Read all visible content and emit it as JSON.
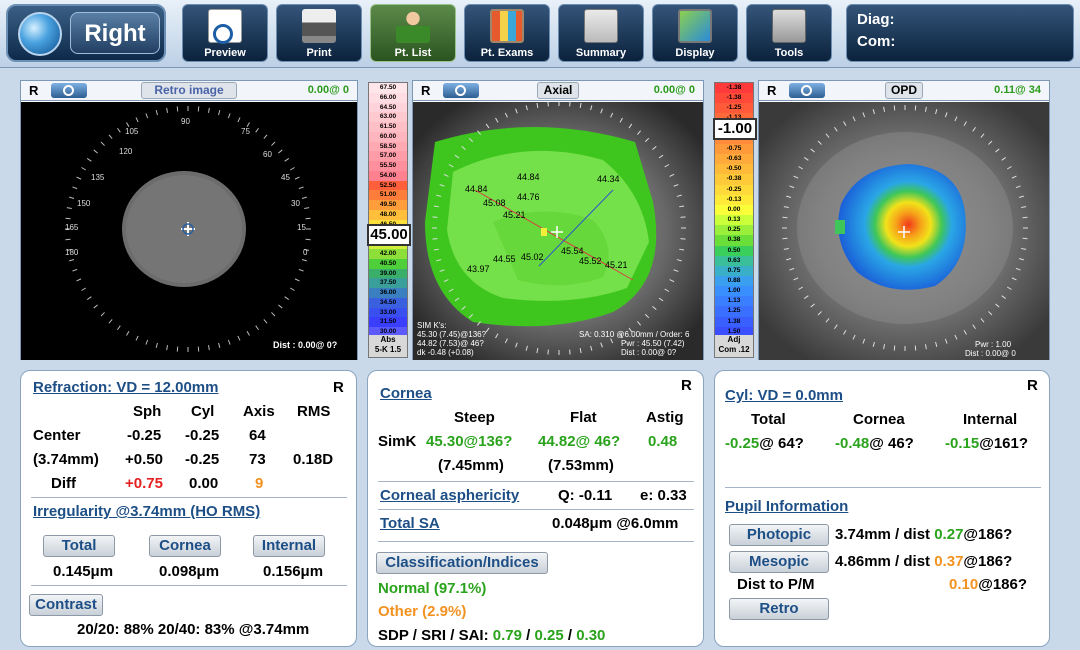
{
  "toolbar": {
    "eye": "Right",
    "buttons": [
      {
        "label": "Preview",
        "icon": "preview-icon"
      },
      {
        "label": "Print",
        "icon": "printer-icon"
      },
      {
        "label": "Pt. List",
        "icon": "patient-icon"
      },
      {
        "label": "Pt. Exams",
        "icon": "exams-icon"
      },
      {
        "label": "Summary",
        "icon": "summary-icon"
      },
      {
        "label": "Display",
        "icon": "display-icon"
      },
      {
        "label": "Tools",
        "icon": "tools-icon"
      }
    ],
    "diag": "Diag:",
    "com": "Com:"
  },
  "retro": {
    "eye": "R",
    "title": "Retro image",
    "value": "0.00@ 0",
    "dist": "Dist : 0.00@ 0?"
  },
  "axial": {
    "eye": "R",
    "title": "Axial",
    "value": "0.00@ 0",
    "points": [
      "44.84",
      "44.34",
      "44.84",
      "44.76",
      "45.08",
      "45.21",
      "44.55",
      "45.02",
      "45.54",
      "45.52",
      "45.21",
      "43.97"
    ],
    "simk_title": "SIM K's:",
    "simk_1": "45.30 (7.45)@136?",
    "simk_2": "44.82 (7.53)@ 46?",
    "simk_3": "dk -0.48 (+0.08)",
    "sa": "SA: 0.310 @6.00mm / Order: 6",
    "pwr": "Pwr : 45.50 (7.42)",
    "dist": "Dist : 0.00@ 0?",
    "scale_values": [
      "67.50",
      "66.00",
      "64.50",
      "63.00",
      "61.50",
      "60.00",
      "58.50",
      "57.00",
      "55.50",
      "54.00",
      "52.50",
      "51.00",
      "49.50",
      "48.00",
      "46.50",
      "45.00",
      "43.50",
      "42.00",
      "40.50",
      "39.00",
      "37.50",
      "36.00",
      "34.50",
      "33.00",
      "31.50",
      "30.00"
    ],
    "scale_current": "45.00",
    "scale_foot": "Abs\n5-K 1.5"
  },
  "opd": {
    "eye": "R",
    "title": "OPD",
    "value": "0.11@ 34",
    "pwr": "Pwr : 1.00",
    "dist": "Dist : 0.00@ 0",
    "scale_values": [
      "-1.38",
      "-1.38",
      "-1.25",
      "-1.13",
      "-1.00",
      "-0.88",
      "-0.75",
      "-0.63",
      "-0.50",
      "-0.38",
      "-0.25",
      "-0.13",
      "0.00",
      "0.13",
      "0.25",
      "0.38",
      "0.50",
      "0.63",
      "0.75",
      "0.88",
      "1.00",
      "1.13",
      "1.25",
      "1.38",
      "1.50"
    ],
    "scale_current": "-1.00",
    "scale_foot": "Adj\nCom .12"
  },
  "refraction": {
    "title": "Refraction: VD = 12.00mm",
    "eye": "R",
    "headers": [
      "Sph",
      "Cyl",
      "Axis",
      "RMS"
    ],
    "rows": [
      {
        "label": "Center",
        "sph": "-0.25",
        "cyl": "-0.25",
        "axis": "64",
        "rms": ""
      },
      {
        "label": "(3.74mm)",
        "sph": "+0.50",
        "cyl": "-0.25",
        "axis": "73",
        "rms": "0.18D"
      },
      {
        "label": "Diff",
        "sph": "+0.75",
        "cyl": "0.00",
        "axis": "9",
        "rms": ""
      }
    ],
    "irregularity_title": "Irregularity @3.74mm (HO RMS)",
    "buttons": [
      "Total",
      "Cornea",
      "Internal"
    ],
    "irregularity_values": [
      "0.145μm",
      "0.098μm",
      "0.156μm"
    ],
    "contrast_label": "Contrast",
    "contrast_value": "20/20: 88%  20/40: 83%  @3.74mm"
  },
  "cornea": {
    "title": "Cornea",
    "eye": "R",
    "headers": [
      "Steep",
      "Flat",
      "Astig"
    ],
    "simk_label": "SimK",
    "steep": "45.30@136?",
    "flat": "44.82@ 46?",
    "astig": "0.48",
    "steep_mm": "(7.45mm)",
    "flat_mm": "(7.53mm)",
    "asph_title": "Corneal asphericity",
    "q_value": "Q: -0.11",
    "e_value": "e: 0.33",
    "sa_title": "Total SA",
    "sa_value": "0.048μm @6.0mm",
    "class_button": "Classification/Indices",
    "normal": "Normal (97.1%)",
    "other": "Other (2.9%)",
    "sdp_label": "SDP / SRI / SAI:",
    "sdp": "0.79",
    "sri": "0.25",
    "sai": "0.30",
    "sep": "/"
  },
  "cyl": {
    "title": "Cyl: VD = 0.0mm",
    "eye": "R",
    "headers": [
      "Total",
      "Cornea",
      "Internal"
    ],
    "total_num": "-0.25",
    "total_axis": "@ 64?",
    "cornea_num": "-0.48",
    "cornea_axis": "@ 46?",
    "internal_num": "-0.15",
    "internal_axis": "@161?",
    "pupil_title": "Pupil Information",
    "photopic_btn": "Photopic",
    "photopic_text": "3.74mm / dist",
    "photopic_num": "0.27",
    "photopic_axis": "@186?",
    "mesopic_btn": "Mesopic",
    "mesopic_text": "4.86mm / dist",
    "mesopic_num": "0.37",
    "mesopic_axis": "@186?",
    "dist_label": "Dist to P/M",
    "dist_num": "0.10",
    "dist_axis": "@186?",
    "retro_btn": "Retro"
  },
  "colors": {
    "accent": "#1d4f86",
    "green": "#2aa31c",
    "orange": "#f39220",
    "red": "#e52020"
  }
}
